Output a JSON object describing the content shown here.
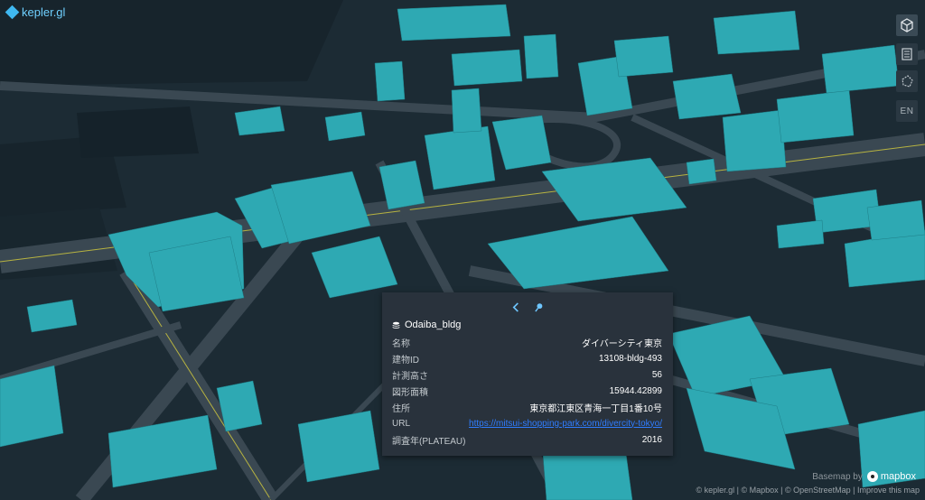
{
  "app": {
    "brand": "kepler.gl",
    "brand_color": "#3fb8f0"
  },
  "map_controls": {
    "icons": [
      "cube-3d-icon",
      "legend-icon",
      "draw-polygon-icon"
    ],
    "language": "EN"
  },
  "tooltip": {
    "layer_name": "Odaiba_bldg",
    "rows": [
      {
        "key": "名称",
        "value": "ダイバーシティ東京"
      },
      {
        "key": "建物ID",
        "value": "13108-bldg-493"
      },
      {
        "key": "計測高さ",
        "value": "56"
      },
      {
        "key": "図形面積",
        "value": "15944.42899"
      },
      {
        "key": "住所",
        "value": "東京都江東区青海一丁目1番10号"
      },
      {
        "key": "URL",
        "value": "https://mitsui-shopping-park.com/divercity-tokyo/"
      },
      {
        "key": "調査年(PLATEAU)",
        "value": "2016"
      }
    ]
  },
  "basemap": {
    "label": "Basemap by",
    "provider": "mapbox",
    "attribution": "© kepler.gl | © Mapbox | © OpenStreetMap | Improve this map"
  },
  "colors": {
    "background": "#1c2b34",
    "building": "#2ea9b3",
    "road": "#3a4852",
    "road_highlight": "#b7b341",
    "link": "#2f7dff"
  }
}
